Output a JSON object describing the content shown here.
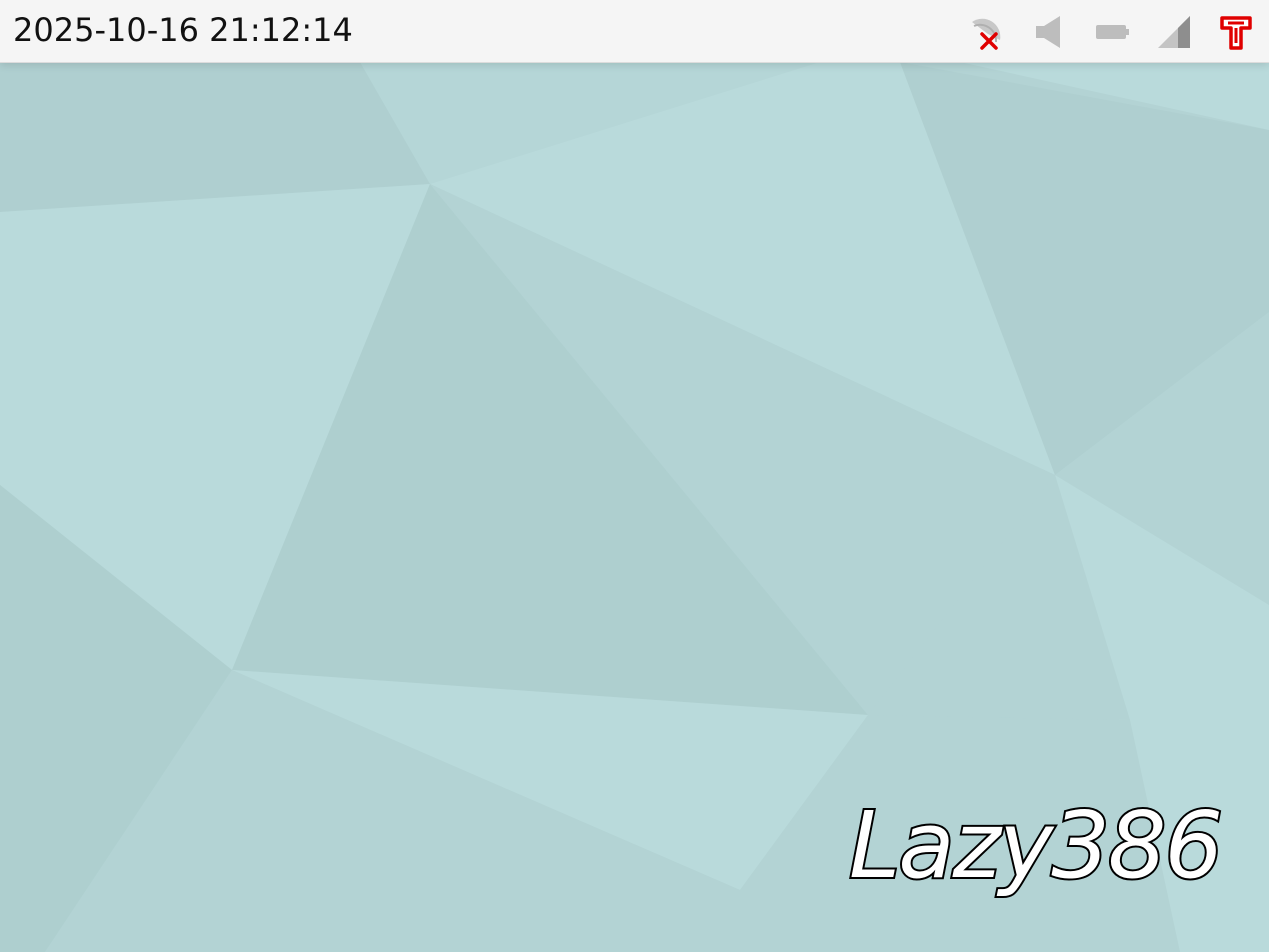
{
  "topbar": {
    "clock_text": "2025-10-16 21:12:14",
    "tray": [
      {
        "icon": "network-disconnected-icon",
        "color": "#e00000"
      },
      {
        "icon": "volume-icon",
        "color": "#bdbdbd"
      },
      {
        "icon": "battery-icon",
        "color": "#bdbdbd"
      },
      {
        "icon": "signal-icon",
        "color": "#9a9a9a"
      },
      {
        "icon": "input-method-icon",
        "color": "#e00000"
      }
    ]
  },
  "desktop": {
    "brand_text": "Lazy386",
    "wallpaper_colors": {
      "light": "#b9dadb",
      "mid": "#b3d3d4",
      "dark": "#aecfcf"
    }
  }
}
